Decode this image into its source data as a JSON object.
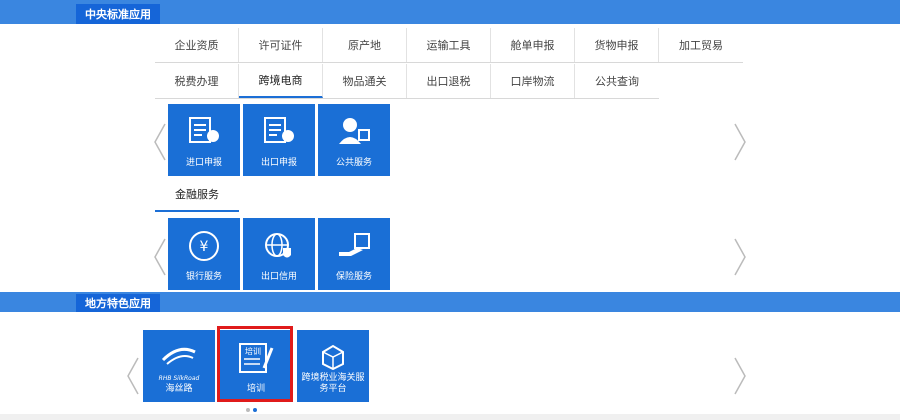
{
  "central_section": {
    "title": "中央标准应用",
    "tabs_row1": [
      "企业资质",
      "许可证件",
      "原产地",
      "运输工具",
      "舱单申报",
      "货物申报",
      "加工贸易"
    ],
    "tabs_row2": [
      "税费办理",
      "跨境电商",
      "物品通关",
      "出口退税",
      "口岸物流",
      "公共查询"
    ],
    "active_tab": "跨境电商",
    "tiles_a": [
      {
        "label": "进口申报",
        "icon": "import-declaration-icon"
      },
      {
        "label": "出口申报",
        "icon": "export-declaration-icon"
      },
      {
        "label": "公共服务",
        "icon": "customer-service-icon"
      }
    ],
    "tab_row3": [
      "金融服务"
    ],
    "tiles_b": [
      {
        "label": "银行服务",
        "icon": "bank-yen-icon"
      },
      {
        "label": "出口信用",
        "icon": "globe-shield-icon"
      },
      {
        "label": "保险服务",
        "icon": "insurance-icon"
      }
    ]
  },
  "local_section": {
    "title": "地方特色应用",
    "tiles": [
      {
        "label": "海丝路",
        "sublabel": "RHB SilkRoad",
        "icon": "silkroad-logo-icon"
      },
      {
        "label": "培训",
        "sublabel": "培训",
        "icon": "training-edit-icon"
      },
      {
        "label": "跨境税业海关服务平台",
        "icon": "package-service-icon"
      }
    ],
    "selected_tile": "培训"
  },
  "colors": {
    "accent": "#1a6fd6",
    "band": "#3a86e0",
    "highlight": "#e01b1b"
  }
}
